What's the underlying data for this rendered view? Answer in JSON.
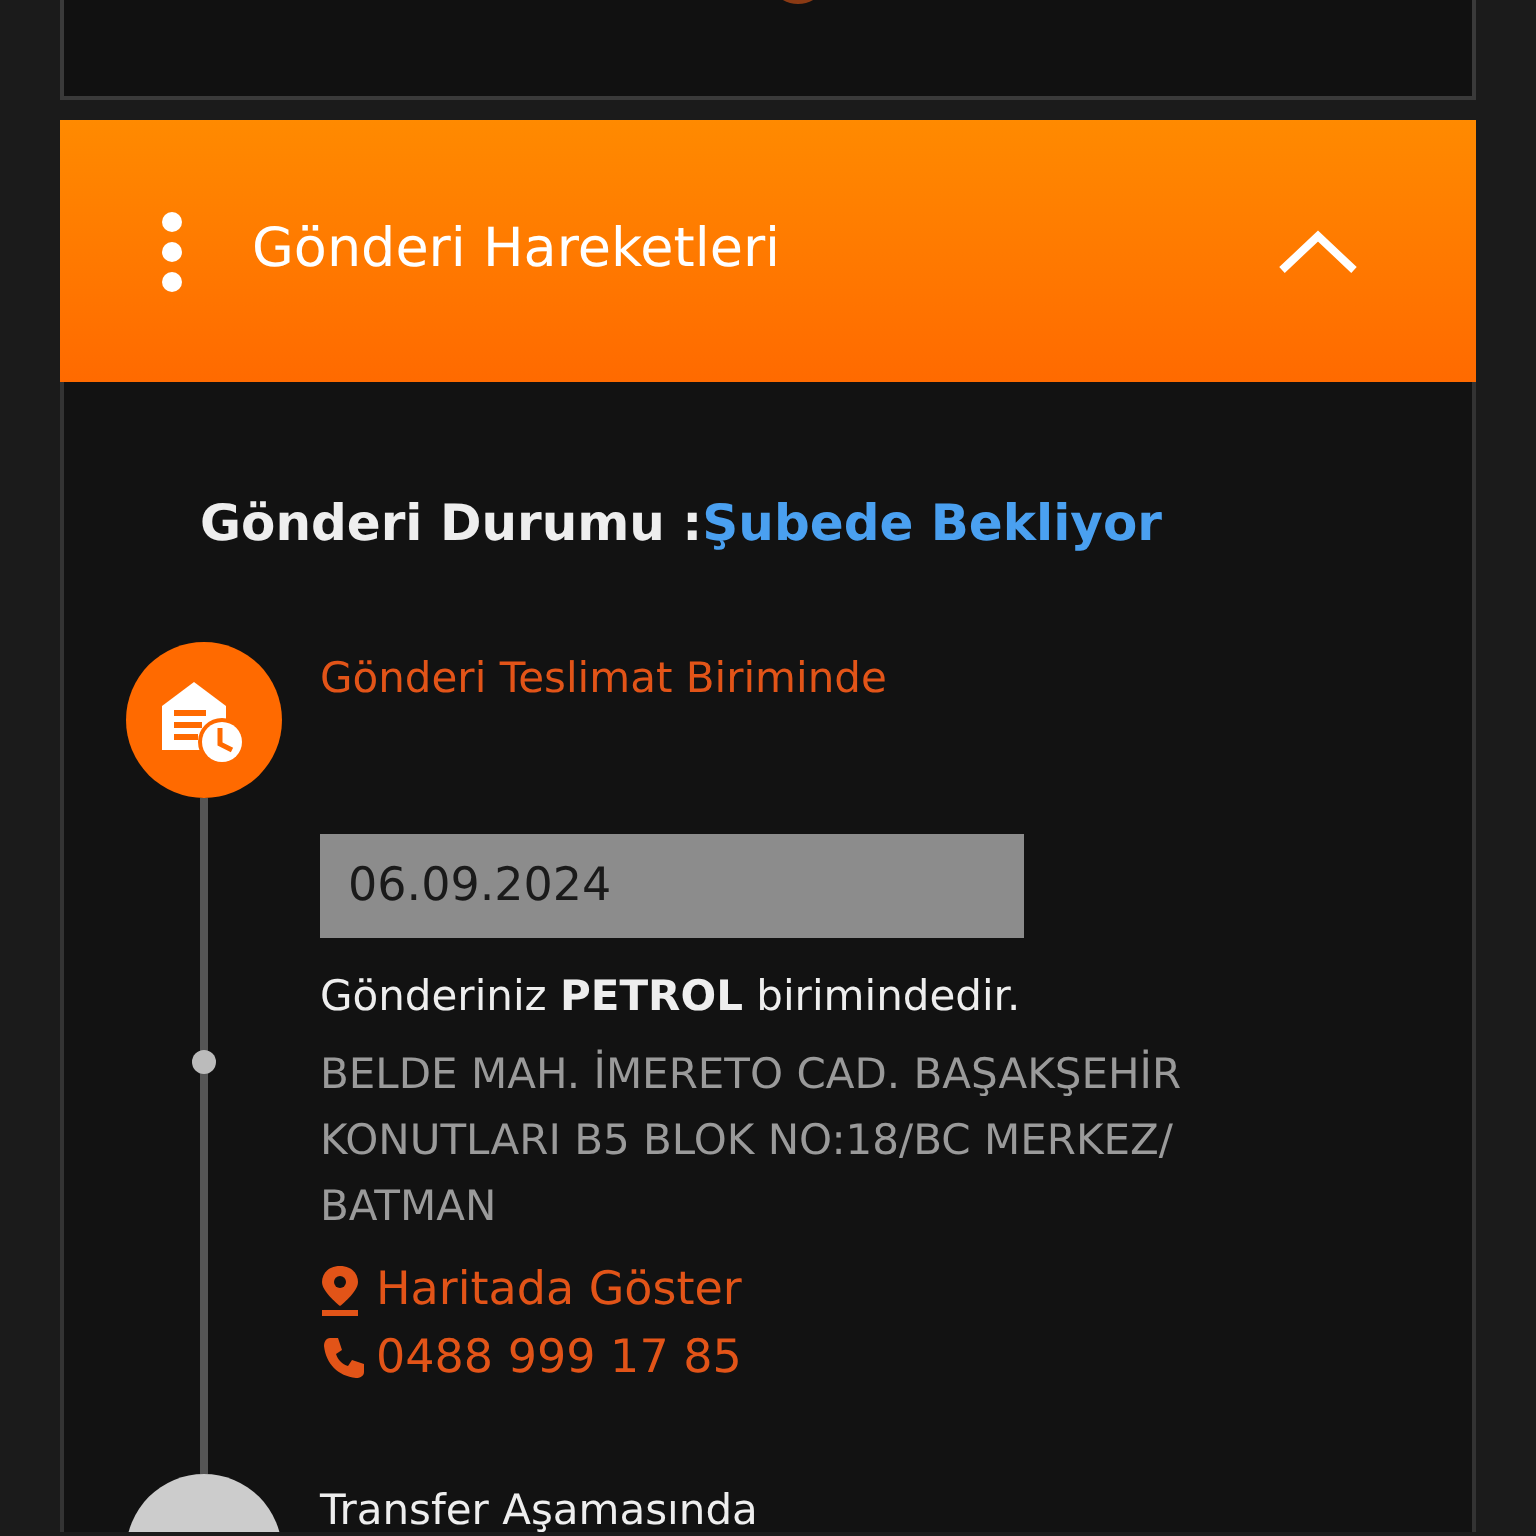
{
  "header": {
    "title": "Gönderi Hareketleri",
    "expanded": true
  },
  "status": {
    "label": "Gönderi Durumu :",
    "value": "Şubede Bekliyor"
  },
  "events": [
    {
      "kind": "active",
      "title": "Gönderi Teslimat Biriminde",
      "date": "06.09.2024",
      "message": "Gönderiniz **PETROL** birimindedir.",
      "address": "BELDE MAH. İMERETO CAD. BAŞAKŞEHİR KONUTLARI B5 BLOK NO:18/BC MERKEZ/ BATMAN",
      "map_link": "Haritada Göster",
      "phone": "0488 999 17 85"
    },
    {
      "kind": "past",
      "title": "Transfer Aşamasında"
    }
  ]
}
